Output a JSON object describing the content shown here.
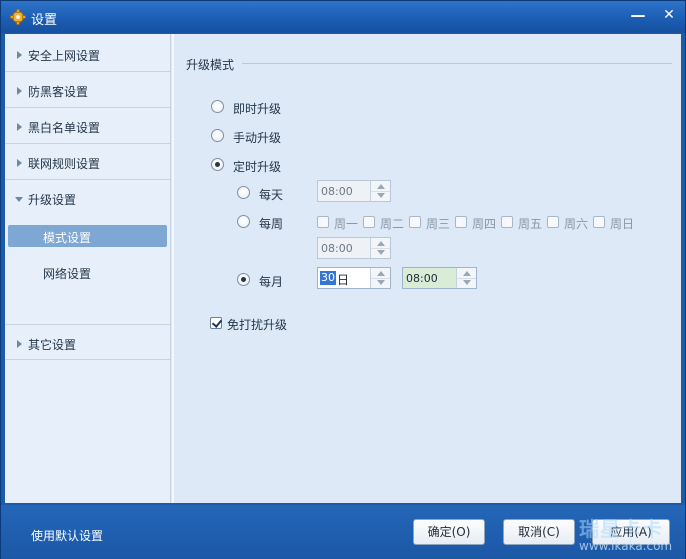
{
  "window": {
    "title": "设置",
    "minimize_glyph": "—",
    "close_glyph": "✕"
  },
  "sidebar": {
    "items": [
      {
        "label": "安全上网设置"
      },
      {
        "label": "防黑客设置"
      },
      {
        "label": "黑白名单设置"
      },
      {
        "label": "联网规则设置"
      },
      {
        "label": "升级设置",
        "expanded": true
      },
      {
        "label": "其它设置"
      }
    ],
    "sub_items": [
      {
        "label": "模式设置",
        "selected": true
      },
      {
        "label": "网络设置"
      }
    ]
  },
  "content": {
    "section_title": "升级模式",
    "modes": [
      {
        "label": "即时升级",
        "checked": false
      },
      {
        "label": "手动升级",
        "checked": false
      },
      {
        "label": "定时升级",
        "checked": true
      }
    ],
    "schedule": {
      "daily": {
        "label": "每天",
        "checked": false,
        "time": "08:00"
      },
      "weekly": {
        "label": "每周",
        "checked": false,
        "time": "08:00",
        "days": [
          "周一",
          "周二",
          "周三",
          "周四",
          "周五",
          "周六",
          "周日"
        ]
      },
      "monthly": {
        "label": "每月",
        "checked": true,
        "day_value": "30",
        "day_unit": "日",
        "time": "08:00"
      }
    },
    "no_disturb": {
      "label": "免打扰升级",
      "checked": true
    }
  },
  "footer": {
    "default_link": "使用默认设置",
    "ok": "确定(O)",
    "cancel": "取消(C)",
    "apply": "应用(A)",
    "watermark_big": "瑞星卡卡",
    "watermark_small": "www.ikaka.com"
  },
  "colors": {
    "titlebar": "#1f61b5",
    "sidebar_selected": "#7ea7d3",
    "content_bg": "#dde9f6",
    "footer": "#1d5aa8"
  }
}
